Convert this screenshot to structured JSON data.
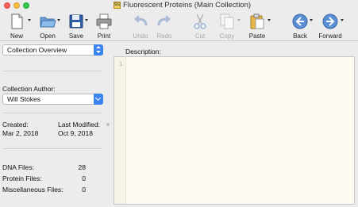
{
  "window": {
    "title": "Fluorescent Proteins  (Main Collection)",
    "doc_icon": "SG"
  },
  "toolbar": {
    "items": [
      {
        "label": "New",
        "icon": "new-doc-icon",
        "enabled": true
      },
      {
        "label": "Open",
        "icon": "folder-icon",
        "enabled": true
      },
      {
        "label": "Save",
        "icon": "floppy-icon",
        "enabled": true
      },
      {
        "label": "Print",
        "icon": "printer-icon",
        "enabled": true
      },
      {
        "label": "Undo",
        "icon": "undo-icon",
        "enabled": false
      },
      {
        "label": "Redo",
        "icon": "redo-icon",
        "enabled": false
      },
      {
        "label": "Cut",
        "icon": "scissors-icon",
        "enabled": false
      },
      {
        "label": "Copy",
        "icon": "copy-icon",
        "enabled": false
      },
      {
        "label": "Paste",
        "icon": "clipboard-icon",
        "enabled": true
      },
      {
        "label": "Back",
        "icon": "back-arrow-icon",
        "enabled": true
      },
      {
        "label": "Forward",
        "icon": "forward-arrow-icon",
        "enabled": true
      }
    ]
  },
  "sidebar": {
    "view_select": "Collection Overview",
    "author_label": "Collection Author:",
    "author_value": "Will Stokes",
    "created_label": "Created:",
    "created_value": "Mar 2, 2018",
    "modified_label": "Last Modified:",
    "modified_value": "Oct 9, 2018",
    "stats": [
      {
        "label": "DNA Files:",
        "value": "28"
      },
      {
        "label": "Protein Files:",
        "value": "0"
      },
      {
        "label": "Miscellaneous Files:",
        "value": "0"
      }
    ]
  },
  "main": {
    "description_label": "Description:",
    "line_number": "1"
  },
  "colors": {
    "accent": "#3b84f0",
    "editor_bg": "#fefaf1",
    "window_bg": "#ececec"
  }
}
